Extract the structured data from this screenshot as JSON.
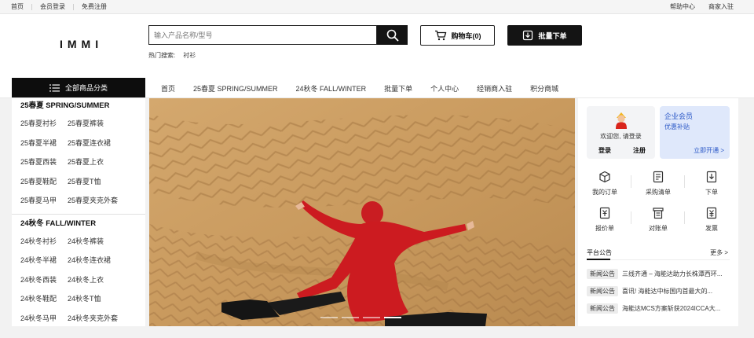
{
  "topbar": {
    "left_links": [
      "首页",
      "会员登录",
      "免费注册"
    ],
    "right_links": [
      "帮助中心",
      "商家入驻"
    ]
  },
  "header": {
    "logo": "IMMI",
    "search_placeholder": "输入产品名称/型号",
    "hot_label": "热门搜索:",
    "hot_keyword": "衬衫",
    "cart_label": "购物车(0)",
    "bulk_label": "批量下单"
  },
  "nav": {
    "all_categories": "全部商品分类",
    "links": [
      "首页",
      "25春夏 SPRING/SUMMER",
      "24秋冬 FALL/WINTER",
      "批量下单",
      "个人中心",
      "经销商入驻",
      "积分商城"
    ]
  },
  "sidebar": {
    "sections": [
      {
        "title": "25春夏 SPRING/SUMMER",
        "rows": [
          [
            "25春夏衬衫",
            "25春夏裤装"
          ],
          [
            "25春夏半裙",
            "25春夏连衣裙"
          ],
          [
            "25春夏西装",
            "25春夏上衣"
          ],
          [
            "25春夏鞋配",
            "25春夏T恤"
          ],
          [
            "25春夏马甲",
            "25春夏夹克外套"
          ]
        ]
      },
      {
        "title": "24秋冬 FALL/WINTER",
        "rows": [
          [
            "24秋冬衬衫",
            "24秋冬裤装"
          ],
          [
            "24秋冬半裙",
            "24秋冬连衣裙"
          ],
          [
            "24秋冬西装",
            "24秋冬上衣"
          ],
          [
            "24秋冬鞋配",
            "24秋冬T恤"
          ],
          [
            "24秋冬马甲",
            "24秋冬夹克外套"
          ]
        ]
      }
    ]
  },
  "banner": {
    "slide_count": 4,
    "active_slide": 4
  },
  "user_panel": {
    "welcome": "欢迎您, 请登录",
    "login": "登录",
    "register": "注册",
    "vip_title": "企业会员",
    "vip_sub": "优惠补贴",
    "vip_open": "立即开通 >"
  },
  "tools": [
    {
      "label": "我的订单",
      "icon": "order-box-icon"
    },
    {
      "label": "采购清单",
      "icon": "purchase-list-icon"
    },
    {
      "label": "下单",
      "icon": "place-order-icon"
    },
    {
      "label": "报价单",
      "icon": "quotation-icon"
    },
    {
      "label": "对账单",
      "icon": "statement-icon"
    },
    {
      "label": "发票",
      "icon": "invoice-icon"
    }
  ],
  "notices": {
    "title": "平台公告",
    "more": "更多 >",
    "items": [
      {
        "tag": "新闻公告",
        "text": "三线齐通 – 海能达助力长株潭西环..."
      },
      {
        "tag": "新闻公告",
        "text": "喜讯! 海能达中标国内首最大的..."
      },
      {
        "tag": "新闻公告",
        "text": "海能达MCS方案斩获2024ICCA大..."
      }
    ]
  },
  "colors": {
    "dark": "#141414",
    "vip_bg": "#dfe8fb",
    "vip_text": "#2b58c7",
    "avatar_red": "#d9251c"
  }
}
